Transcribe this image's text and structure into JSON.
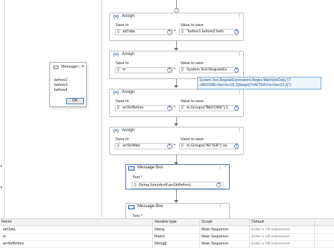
{
  "canvas": {
    "assigns": [
      {
        "title": "Assign",
        "save_to_label": "Save to",
        "value_label": "Value to save",
        "save_to": "strData",
        "value": "\"before1 before2 befo"
      },
      {
        "title": "Assign",
        "save_to_label": "Save to",
        "value_label": "Value to save",
        "save_to": "m",
        "value": "System.Text.RegularEx"
      },
      {
        "title": "Assign",
        "save_to_label": "Save to",
        "value_label": "Value to save",
        "save_to": "arrStrBefore",
        "value": "m.Groups(\"BEFORE\").C"
      },
      {
        "title": "Assign",
        "save_to_label": "Save to",
        "value_label": "Value to save",
        "save_to": "arrStrAfter",
        "value": "m.Groups(\"AFTER\").Va"
      }
    ],
    "tooltip": "System.Text.RegularExpressions.Regex.Match(strData,\"(?<BEFORE>\\\\w+\\\\s+){1,3}(target)?<AFTER>\\\\s+\\\\w+){1,3}\")",
    "message_boxes": [
      {
        "title": "Message Box",
        "text_label": "Text *",
        "text_value": "String.Join(vbcrlf,arrStrBefore)"
      },
      {
        "title": "Message Box",
        "text_label": "Text *"
      }
    ],
    "field_icon_glyph": "{}",
    "add_glyph": "+",
    "more_glyph": "⋮",
    "collapse_glyph": "⌃"
  },
  "dialog": {
    "title": "Message...",
    "minimize_glyph": "—",
    "close_glyph": "✕",
    "lines": [
      "before2",
      "before3",
      "before4"
    ],
    "ok_label": "OK"
  },
  "variables": {
    "headers": [
      "Name",
      "Variable type",
      "Scope",
      "Default"
    ],
    "rows": [
      {
        "name": "strData",
        "type": "String",
        "scope": "Main Sequence",
        "default": "Enter a VB expression"
      },
      {
        "name": "m",
        "type": "Match",
        "scope": "Main Sequence",
        "default": "Enter a VB expression"
      },
      {
        "name": "arrStrBefore",
        "type": "String[]",
        "scope": "Main Sequence",
        "default": "Enter a VB expression"
      }
    ]
  },
  "colors": {
    "accent": "#2b579a",
    "selected_border": "#3f6fb2",
    "tooltip_bg": "#eef6fd"
  }
}
